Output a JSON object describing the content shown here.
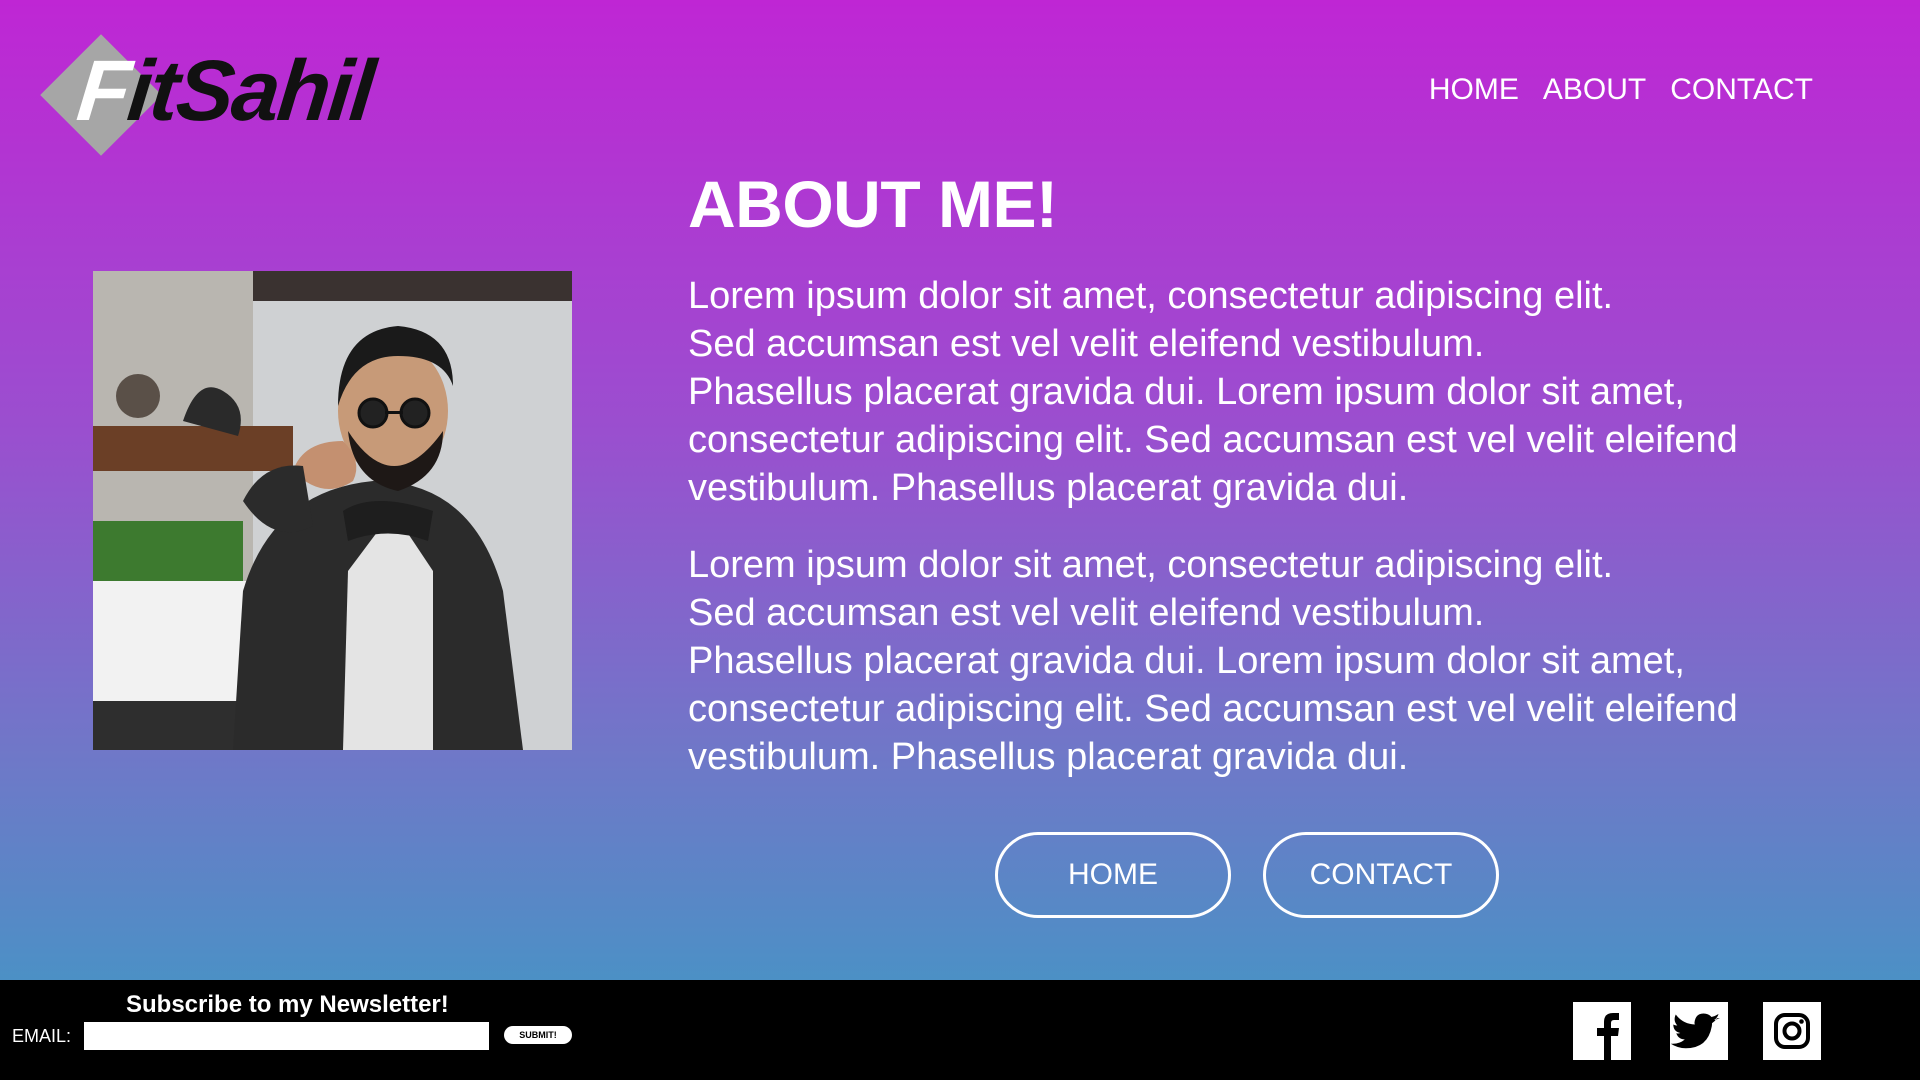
{
  "brand": {
    "logo_text_first": "F",
    "logo_text_rest": "itSahil"
  },
  "nav": {
    "items": [
      {
        "label": "HOME"
      },
      {
        "label": "ABOUT"
      },
      {
        "label": "CONTACT"
      }
    ]
  },
  "about": {
    "title": "ABOUT ME!",
    "paragraphs": [
      {
        "lines": [
          "Lorem ipsum dolor sit amet, consectetur adipiscing elit.",
          "Sed accumsan est vel velit eleifend vestibulum.",
          "Phasellus placerat gravida dui. Lorem ipsum dolor sit amet,",
          "consectetur adipiscing elit. Sed accumsan est vel velit eleifend",
          "vestibulum. Phasellus placerat gravida dui."
        ]
      },
      {
        "lines": [
          "Lorem ipsum dolor sit amet, consectetur adipiscing elit.",
          "Sed accumsan est vel velit eleifend vestibulum.",
          "Phasellus placerat gravida dui. Lorem ipsum dolor sit amet,",
          "consectetur adipiscing elit. Sed accumsan est vel velit eleifend",
          "vestibulum. Phasellus placerat gravida dui."
        ]
      }
    ]
  },
  "buttons": {
    "home_label": "HOME",
    "contact_label": "CONTACT"
  },
  "footer": {
    "newsletter_title": "Subscribe to my Newsletter!",
    "email_label": "EMAIL:",
    "email_value": "",
    "submit_label": "SUBMIT!",
    "social": [
      {
        "icon": "facebook-icon"
      },
      {
        "icon": "twitter-icon"
      },
      {
        "icon": "instagram-icon"
      }
    ]
  },
  "colors": {
    "gradient_top": "#bf26d4",
    "gradient_bottom": "#3c9bc4",
    "footer_bg": "#000000",
    "text": "#ffffff"
  }
}
